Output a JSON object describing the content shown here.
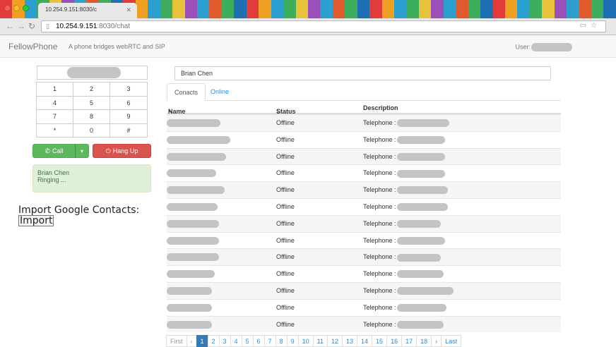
{
  "browser": {
    "tab_title": "10.254.9.151:8030/c",
    "url_host": "10.254.9.151",
    "url_path": ":8030/chat",
    "stripe_colors": [
      "#e23b3b",
      "#f0a020",
      "#2b9fd0",
      "#3dae5c",
      "#e8c23a",
      "#9b4fb8",
      "#2b9fd0",
      "#e05a2b",
      "#3dae5c",
      "#1f6fb5",
      "#e23b3b",
      "#f0a020",
      "#2b9fd0",
      "#3dae5c",
      "#e8c23a",
      "#9b4fb8",
      "#2b9fd0",
      "#e05a2b",
      "#3dae5c",
      "#1f6fb5",
      "#e23b3b",
      "#f0a020",
      "#2b9fd0",
      "#3dae5c",
      "#e8c23a",
      "#9b4fb8",
      "#2b9fd0",
      "#e05a2b",
      "#3dae5c",
      "#1f6fb5",
      "#e23b3b",
      "#f0a020",
      "#2b9fd0",
      "#3dae5c",
      "#e8c23a",
      "#9b4fb8",
      "#2b9fd0",
      "#e05a2b",
      "#3dae5c",
      "#1f6fb5",
      "#e23b3b",
      "#f0a020",
      "#2b9fd0",
      "#3dae5c",
      "#e8c23a",
      "#9b4fb8",
      "#2b9fd0",
      "#e05a2b",
      "#3dae5c",
      "#1f6fb5"
    ]
  },
  "app": {
    "brand": "FellowPhone",
    "tagline": "A phone bridges webRTC and SIP",
    "user_label": "User:"
  },
  "dialer": {
    "keys": [
      "1",
      "2",
      "3",
      "4",
      "5",
      "6",
      "7",
      "8",
      "9",
      "*",
      "0",
      "#"
    ],
    "call_label": "Call",
    "hangup_label": "Hang Up",
    "status_name": "Brian Chen",
    "status_state": "Ringing ..."
  },
  "import": {
    "title": "Import Google Contacts:",
    "button": "Import"
  },
  "contacts": {
    "selected": "Brian Chen",
    "tabs": [
      "Conacts",
      "Online"
    ],
    "columns": {
      "name": "Name",
      "status": "Status",
      "description": "Description"
    },
    "rows": [
      {
        "status": "Offline",
        "desc_prefix": "Telephone :"
      },
      {
        "status": "Offline",
        "desc_prefix": "Telephone :"
      },
      {
        "status": "Offline",
        "desc_prefix": "Telephone :"
      },
      {
        "status": "Offline",
        "desc_prefix": "Telephone :"
      },
      {
        "status": "Offline",
        "desc_prefix": "Telephone :"
      },
      {
        "status": "Offline",
        "desc_prefix": "Telephone :"
      },
      {
        "status": "Offline",
        "desc_prefix": "Telephone :"
      },
      {
        "status": "Offline",
        "desc_prefix": "Telephone :"
      },
      {
        "status": "Offline",
        "desc_prefix": "Telephone :"
      },
      {
        "status": "Offline",
        "desc_prefix": "Telephone :"
      },
      {
        "status": "Offline",
        "desc_prefix": "Telephone :"
      },
      {
        "status": "Offline",
        "desc_prefix": "Telephone :"
      },
      {
        "status": "Offline",
        "desc_prefix": "Telephone :"
      }
    ]
  },
  "pagination": {
    "first": "First",
    "prev": "‹",
    "pages": [
      "1",
      "2",
      "3",
      "4",
      "5",
      "6",
      "7",
      "8",
      "9",
      "10",
      "11",
      "12",
      "13",
      "14",
      "15",
      "16",
      "17",
      "18"
    ],
    "active_page": "1",
    "next": "›",
    "last": "Last"
  }
}
